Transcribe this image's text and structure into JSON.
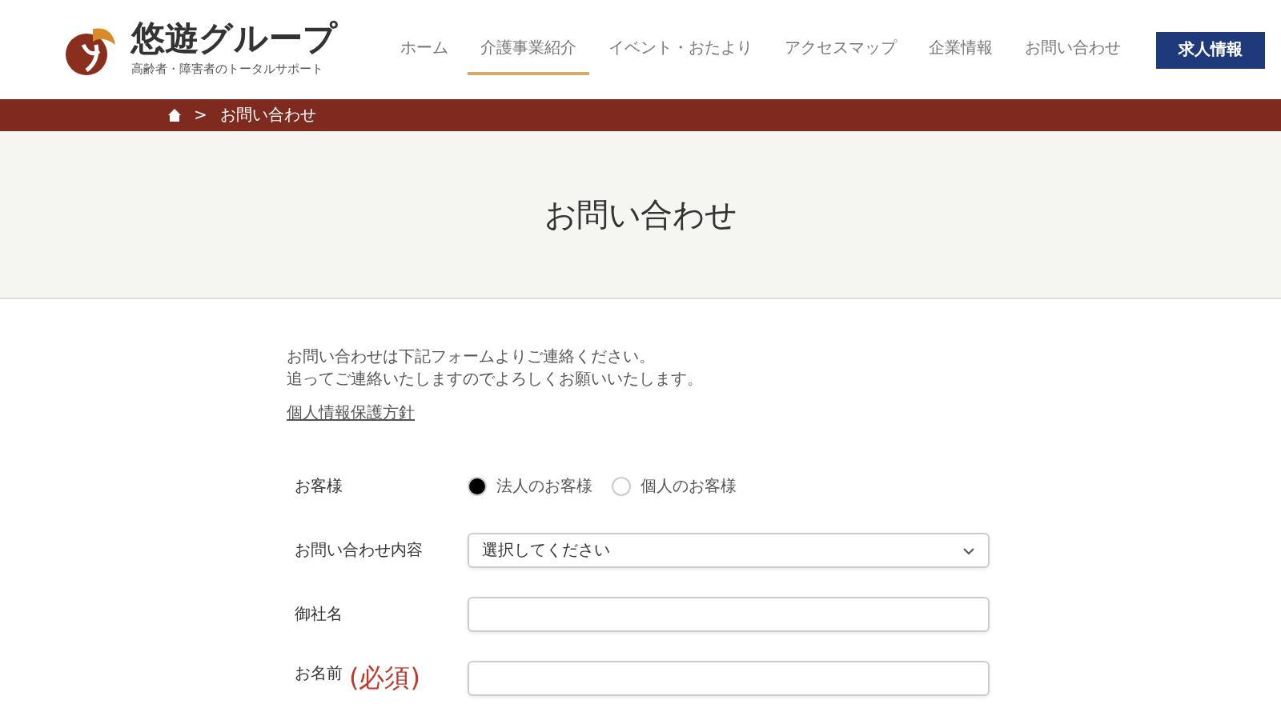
{
  "logo": {
    "name": "悠遊グループ",
    "tagline": "高齢者・障害者のトータルサポート"
  },
  "nav": [
    {
      "label": "ホーム",
      "selected": false
    },
    {
      "label": "介護事業紹介",
      "selected": true
    },
    {
      "label": "イベント・おたより",
      "selected": false
    },
    {
      "label": "アクセスマップ",
      "selected": false
    },
    {
      "label": "企業情報",
      "selected": false
    },
    {
      "label": "お問い合わせ",
      "selected": false
    }
  ],
  "recruit_button": "求人情報",
  "breadcrumb": {
    "separator": ">",
    "current": "お問い合わせ"
  },
  "page_title": "お問い合わせ",
  "intro": [
    "お問い合わせは下記フォームよりご連絡ください。",
    "追ってご連絡いたしますのでよろしくお願いいたします。"
  ],
  "privacy_link": "個人情報保護方針",
  "form": [
    {
      "kind": "radio",
      "label": "お客様",
      "options": [
        {
          "label": "法人のお客様",
          "selected": true
        },
        {
          "label": "個人のお客様",
          "selected": false
        }
      ]
    },
    {
      "kind": "select",
      "label": "お問い合わせ内容",
      "value": "選択してください"
    },
    {
      "kind": "text",
      "label": "御社名"
    },
    {
      "kind": "text",
      "label": "お名前",
      "required": "(必須)"
    }
  ]
}
